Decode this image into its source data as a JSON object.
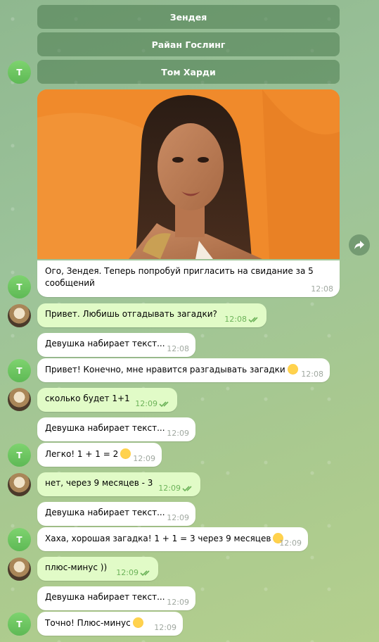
{
  "keyboard": [
    {
      "label": "Зендея"
    },
    {
      "label": "Райан Гослинг"
    },
    {
      "label": "Том Харди"
    }
  ],
  "bot_avatar_letter": "T",
  "colors": {
    "incoming_bubble": "#ffffff",
    "outgoing_bubble": "#e1fbc7",
    "accent_green": "#6db35a"
  },
  "messages": [
    {
      "text": "Ого, Зендея. Теперь попробуй пригласить на свидание за 5 сообщений",
      "time": "12:08"
    },
    {
      "text": "Привет. Любишь отгадывать загадки?",
      "time": "12:08"
    },
    {
      "text": "Девушка набирает текст...",
      "time": "12:08"
    },
    {
      "text": "Привет! Конечно, мне нравится разгадывать загадки",
      "time": "12:08"
    },
    {
      "text": "сколько будет 1+1",
      "time": "12:09"
    },
    {
      "text": "Девушка набирает текст...",
      "time": "12:09"
    },
    {
      "text": "Легко! 1 + 1 = 2",
      "time": "12:09"
    },
    {
      "text": "нет, через 9 месяцев - 3",
      "time": "12:09"
    },
    {
      "text": "Девушка набирает текст...",
      "time": "12:09"
    },
    {
      "text": "Хаха, хорошая загадка! 1 + 1 = 3 через 9 месяцев",
      "time": "12:09"
    },
    {
      "text": "плюс-минус ))",
      "time": "12:09"
    },
    {
      "text": "Девушка набирает текст...",
      "time": "12:09"
    },
    {
      "text": "Точно! Плюс-минус",
      "time": "12:09"
    }
  ]
}
